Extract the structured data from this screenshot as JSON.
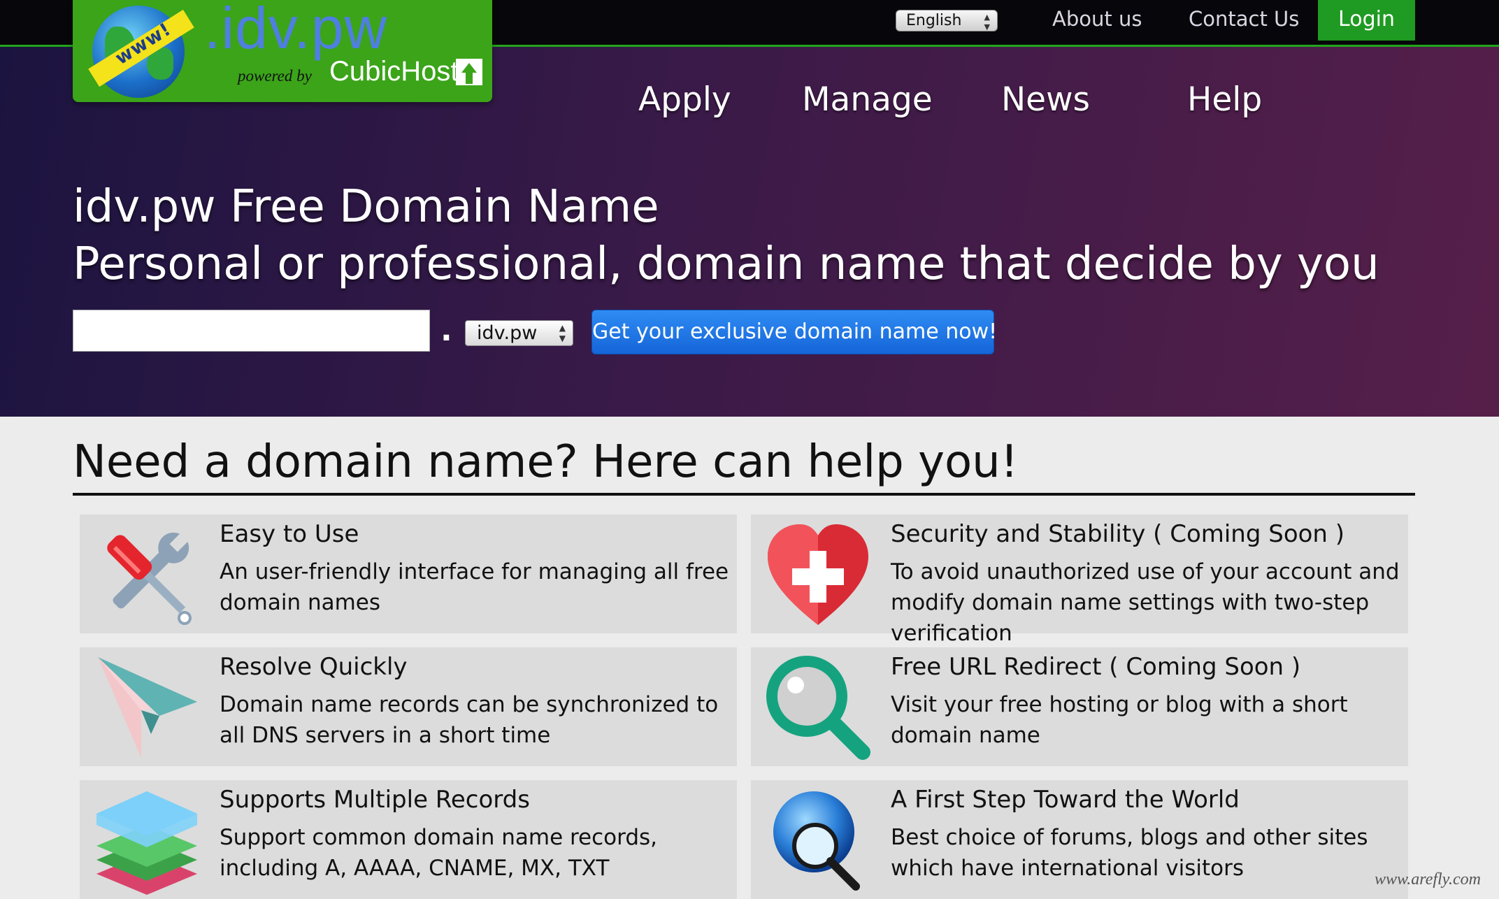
{
  "topbar": {
    "language": "English",
    "links": [
      "About us",
      "Contact Us"
    ],
    "login": "Login"
  },
  "logo": {
    "globe_text": "www!",
    "domain": ".idv.pw",
    "powered_by": "powered by",
    "brand": "CubicHost"
  },
  "nav": [
    "Apply",
    "Manage",
    "News",
    "Help"
  ],
  "hero": {
    "title": "idv.pw Free Domain Name",
    "subtitle": "Personal or professional, domain name that decide by you",
    "input_value": "",
    "separator": ".",
    "tld": "idv.pw",
    "cta": "Get your exclusive domain name now!"
  },
  "features": {
    "heading": "Need a domain name? Here can help you!",
    "items": [
      {
        "icon": "tools-icon",
        "title": "Easy to Use",
        "desc": "An user-friendly interface for managing all free domain names"
      },
      {
        "icon": "heart-plus-icon",
        "title": "Security and Stability ( Coming Soon )",
        "desc": "To avoid unauthorized use of your account and modify domain name settings with two-step verification"
      },
      {
        "icon": "paper-plane-icon",
        "title": "Resolve Quickly",
        "desc": "Domain name records can be synchronized to all DNS servers in a short time"
      },
      {
        "icon": "magnifier-icon",
        "title": "Free URL Redirect ( Coming Soon )",
        "desc": "Visit your free hosting or blog with a short domain name"
      },
      {
        "icon": "layers-icon",
        "title": "Supports Multiple Records",
        "desc": "Support common domain name records, including A, AAAA, CNAME, MX, TXT"
      },
      {
        "icon": "globe-search-icon",
        "title": "A First Step Toward the World",
        "desc": "Best choice of forums, blogs and other sites which have international visitors"
      }
    ]
  },
  "watermark": "www.arefly.com",
  "colors": {
    "topbar": "#07060a",
    "accent_green": "#1f9a22",
    "hero_start": "#1c1440",
    "hero_end": "#561f4a",
    "cta_blue": "#1f78e8",
    "card_bg": "#dcdcdc",
    "page_bg": "#ececec"
  }
}
